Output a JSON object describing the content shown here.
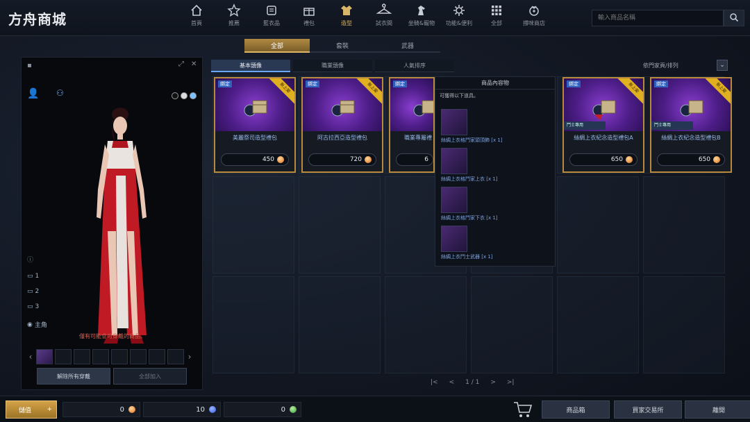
{
  "app": {
    "title": "方舟商城"
  },
  "nav": {
    "items": [
      {
        "label": "首頁",
        "icon": "home-icon"
      },
      {
        "label": "推薦",
        "icon": "star-icon"
      },
      {
        "label": "藍衣品",
        "icon": "box-icon"
      },
      {
        "label": "禮包",
        "icon": "gift-icon"
      },
      {
        "label": "造型",
        "icon": "outfit-icon"
      },
      {
        "label": "試衣間",
        "icon": "hanger-icon"
      },
      {
        "label": "坐騎&寵物",
        "icon": "horse-icon"
      },
      {
        "label": "功能&便利",
        "icon": "gear-icon"
      },
      {
        "label": "全部",
        "icon": "grid-icon"
      },
      {
        "label": "撐咪商店",
        "icon": "shop-icon"
      }
    ],
    "active_index": 4
  },
  "search": {
    "placeholder": "輸入商品名稱"
  },
  "category_tabs": [
    "全部",
    "套裝",
    "武器"
  ],
  "sub_tabs": [
    "基本頭像",
    "職業頭像",
    "人氣排序"
  ],
  "sort": {
    "label": "依門家頁/排列"
  },
  "character_panel": {
    "hint": "僅有可能會可穿戴的商品。",
    "buttons": {
      "unequip": "解除所有穿戴",
      "select_all": "全部加入"
    },
    "side_labels": [
      "1",
      "2",
      "3",
      "主角"
    ]
  },
  "products": [
    {
      "name": "美麗祭司造型禮包",
      "price": "450",
      "badge": "綁定",
      "new": "新上架",
      "tag": ""
    },
    {
      "name": "阿古拉西亞造型禮包",
      "price": "720",
      "badge": "綁定",
      "new": "新上架",
      "tag": ""
    },
    {
      "name": "職業專屬禮",
      "price": "6",
      "badge": "綁定",
      "new": "",
      "tag": ""
    },
    {
      "name": "絲綢上衣紀念造型禮包A",
      "price": "650",
      "badge": "綁定",
      "new": "新上架",
      "tag": "鬥士專用"
    },
    {
      "name": "絲綢上衣紀念造型禮包B",
      "price": "650",
      "badge": "綁定",
      "new": "新上架",
      "tag": "鬥士專用"
    }
  ],
  "popup": {
    "title": "商品內容物",
    "subtitle": "可獲得以下道具。",
    "items": [
      "絲綢上衣格鬥家頭頂飾 [x 1]",
      "絲綢上衣格鬥家上衣 [x 1]",
      "絲綢上衣格鬥家下衣 [x 1]",
      "絲綢上衣鬥士武器 [x 1]"
    ]
  },
  "pager": {
    "first": "|<",
    "prev": "<",
    "current": "1 / 1",
    "next": ">",
    "last": ">|"
  },
  "bottom": {
    "charge_label": "儲值",
    "currencies": [
      {
        "value": "0",
        "icon": "royal-crystal-icon",
        "color": "#e07020"
      },
      {
        "value": "10",
        "icon": "blue-crystal-icon",
        "color": "#3a6aff"
      },
      {
        "value": "0",
        "icon": "green-coin-icon",
        "color": "#4ab04a"
      }
    ],
    "buttons": [
      "商品箱",
      "買家交易所",
      "離開"
    ]
  }
}
